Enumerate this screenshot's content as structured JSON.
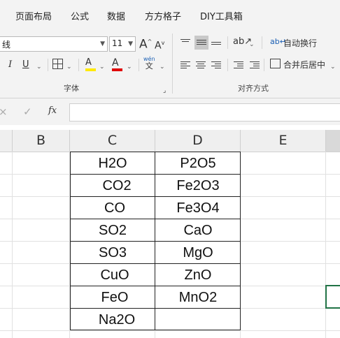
{
  "tabs": [
    "页面布局",
    "公式",
    "数据",
    "方方格子",
    "DIY工具箱"
  ],
  "ribbon": {
    "font_name": "线",
    "font_size": "11",
    "grow_font": "A",
    "shrink_font": "A",
    "italic": "I",
    "underline": "U",
    "fill_color_letter": "A",
    "font_color_letter": "A",
    "wen_top": "wén",
    "wen_bottom": "文",
    "wrap_text": "自动换行",
    "merge_center": "合并后居中",
    "group_font": "字体",
    "group_align": "对齐方式",
    "colors": {
      "fill": "#ffe900",
      "font": "#e00000"
    }
  },
  "formula_bar": {
    "cancel": "×",
    "enter": "✓",
    "fx": "fx",
    "value": ""
  },
  "columns": [
    "B",
    "C",
    "D",
    "E"
  ],
  "rows": [
    {
      "c": "H2O",
      "d": "P2O5"
    },
    {
      "c": "CO2",
      "d": "Fe2O3"
    },
    {
      "c": "CO",
      "d": "Fe3O4"
    },
    {
      "c": "SO2",
      "d": "CaO"
    },
    {
      "c": "SO3",
      "d": "MgO"
    },
    {
      "c": "CuO",
      "d": "ZnO"
    },
    {
      "c": "FeO",
      "d": "MnO2"
    },
    {
      "c": "Na2O",
      "d": ""
    }
  ]
}
